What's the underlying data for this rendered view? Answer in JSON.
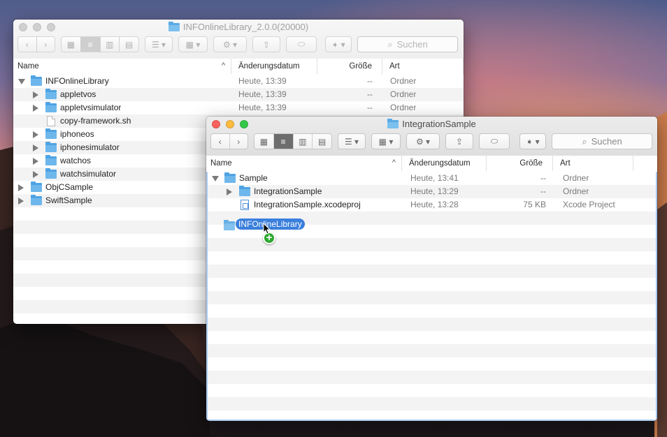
{
  "background_window": {
    "title": "INFOnlineLibrary_2.0.0(20000)",
    "search_placeholder": "Suchen",
    "columns": {
      "name": "Name",
      "date": "Änderungsdatum",
      "size": "Größe",
      "kind": "Art"
    },
    "rows": [
      {
        "name": "INFOnlineLibrary",
        "date": "Heute, 13:39",
        "size": "--",
        "kind": "Ordner",
        "level": 0,
        "type": "folder",
        "disclosure": "open"
      },
      {
        "name": "appletvos",
        "date": "Heute, 13:39",
        "size": "--",
        "kind": "Ordner",
        "level": 1,
        "type": "folder",
        "disclosure": "closed"
      },
      {
        "name": "appletvsimulator",
        "date": "Heute, 13:39",
        "size": "--",
        "kind": "Ordner",
        "level": 1,
        "type": "folder",
        "disclosure": "closed"
      },
      {
        "name": "copy-framework.sh",
        "date": "",
        "size": "",
        "kind": "",
        "level": 1,
        "type": "file",
        "disclosure": "none"
      },
      {
        "name": "iphoneos",
        "date": "",
        "size": "",
        "kind": "",
        "level": 1,
        "type": "folder",
        "disclosure": "closed"
      },
      {
        "name": "iphonesimulator",
        "date": "",
        "size": "",
        "kind": "",
        "level": 1,
        "type": "folder",
        "disclosure": "closed"
      },
      {
        "name": "watchos",
        "date": "",
        "size": "",
        "kind": "",
        "level": 1,
        "type": "folder",
        "disclosure": "closed"
      },
      {
        "name": "watchsimulator",
        "date": "",
        "size": "",
        "kind": "",
        "level": 1,
        "type": "folder",
        "disclosure": "closed"
      },
      {
        "name": "ObjCSample",
        "date": "",
        "size": "",
        "kind": "",
        "level": 0,
        "type": "folder",
        "disclosure": "closed"
      },
      {
        "name": "SwiftSample",
        "date": "",
        "size": "",
        "kind": "",
        "level": 0,
        "type": "folder",
        "disclosure": "closed"
      }
    ]
  },
  "front_window": {
    "title": "IntegrationSample",
    "search_placeholder": "Suchen",
    "columns": {
      "name": "Name",
      "date": "Änderungsdatum",
      "size": "Größe",
      "kind": "Art"
    },
    "rows": [
      {
        "name": "Sample",
        "date": "Heute, 13:41",
        "size": "--",
        "kind": "Ordner",
        "level": 0,
        "type": "folder",
        "disclosure": "open"
      },
      {
        "name": "IntegrationSample",
        "date": "Heute, 13:29",
        "size": "--",
        "kind": "Ordner",
        "level": 1,
        "type": "folder",
        "disclosure": "closed"
      },
      {
        "name": "IntegrationSample.xcodeproj",
        "date": "Heute, 13:28",
        "size": "75 KB",
        "kind": "Xcode Project",
        "level": 1,
        "type": "xcodeproj",
        "disclosure": "none"
      }
    ]
  },
  "drag_item": {
    "label": "INFOnlineLibrary",
    "badge": "+"
  },
  "colors": {
    "selection": "#3b7fdc",
    "folder": "#6eb7ec",
    "copy_badge": "#2fa82f"
  }
}
